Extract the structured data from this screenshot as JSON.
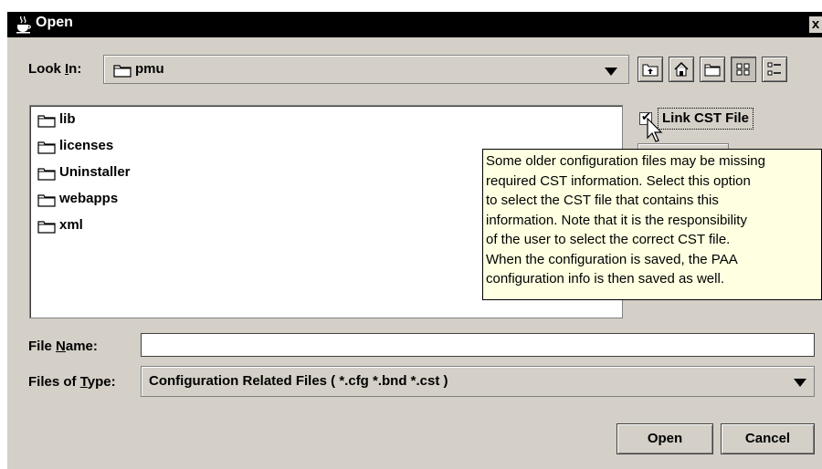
{
  "window": {
    "title": "Open",
    "close_glyph": "x"
  },
  "look_in": {
    "label_pre": "Look ",
    "label_mnemonic": "I",
    "label_post": "n:",
    "value": "pmu",
    "icon": "folder-icon"
  },
  "toolbar": {
    "buttons": [
      {
        "name": "up-one-level-button",
        "icon": "up-folder-icon"
      },
      {
        "name": "home-button",
        "icon": "home-icon"
      },
      {
        "name": "new-folder-button",
        "icon": "new-folder-icon"
      },
      {
        "name": "list-view-button",
        "icon": "list-view-icon",
        "pressed": true
      },
      {
        "name": "details-view-button",
        "icon": "details-view-icon"
      }
    ]
  },
  "files": [
    "lib",
    "licenses",
    "Uninstaller",
    "webapps",
    "xml"
  ],
  "link_cst": {
    "label": "Link CST File",
    "checked": true,
    "mark": "✔"
  },
  "tooltip": {
    "lines": [
      "Some older configuration files may be missing",
      "required CST information. Select this option",
      "to select the CST file that contains this",
      "information. Note that it is the responsibility",
      "of the user to select the correct CST file.",
      "When the configuration is saved, the PAA",
      "configuration info is then saved as well."
    ]
  },
  "file_name": {
    "label_pre": "File ",
    "label_mnemonic": "N",
    "label_post": "ame:",
    "value": ""
  },
  "files_of_type": {
    "label_pre": "Files of ",
    "label_mnemonic": "T",
    "label_post": "ype:",
    "value": "Configuration Related Files ( *.cfg *.bnd *.cst )"
  },
  "buttons": {
    "open": "Open",
    "cancel": "Cancel"
  }
}
